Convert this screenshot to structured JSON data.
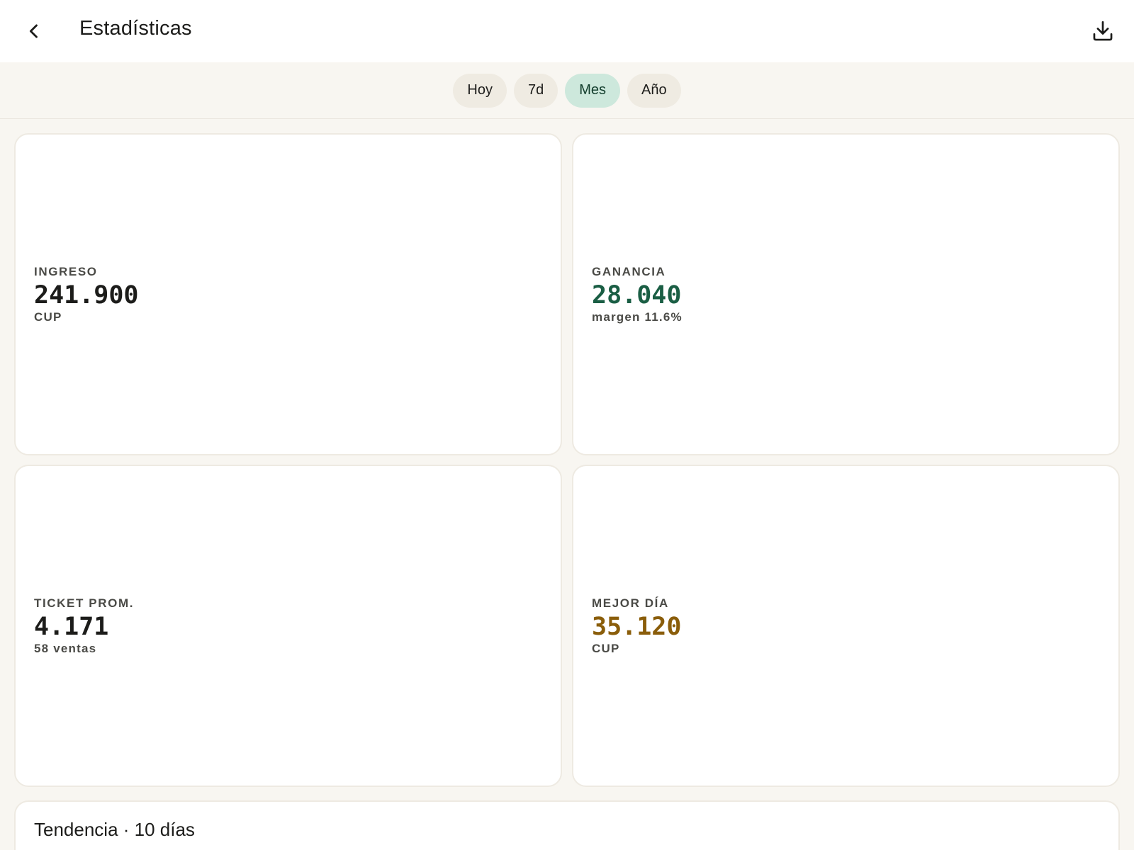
{
  "appbar": {
    "title": "Estadísticas",
    "back_icon": "chevron-left-icon",
    "download_icon": "download-icon"
  },
  "filters": [
    {
      "label": "Hoy",
      "active": false
    },
    {
      "label": "7d",
      "active": false
    },
    {
      "label": "Mes",
      "active": true
    },
    {
      "label": "Año",
      "active": false
    }
  ],
  "stats": {
    "ingreso": {
      "label": "INGRESO",
      "value": "241.900",
      "sub": "CUP",
      "color": "#1c1c1a"
    },
    "ganancia": {
      "label": "GANANCIA",
      "value": "28.040",
      "sub": "margen 11.6%",
      "color": "#1a5e44"
    },
    "ticket": {
      "label": "TICKET PROM.",
      "value": "4.171",
      "sub": "58 ventas",
      "color": "#1c1c1a"
    },
    "mejor_dia": {
      "label": "MEJOR DÍA",
      "value": "35.120",
      "sub": "CUP",
      "color": "#8a5d0a"
    }
  },
  "trend": {
    "title": "Tendencia · 10 días"
  },
  "colors": {
    "background": "#f8f6f1",
    "chip": "#efebe2",
    "chip_active": "#cde8dc",
    "profit": "#1a5e44",
    "best_day": "#8a5d0a"
  }
}
